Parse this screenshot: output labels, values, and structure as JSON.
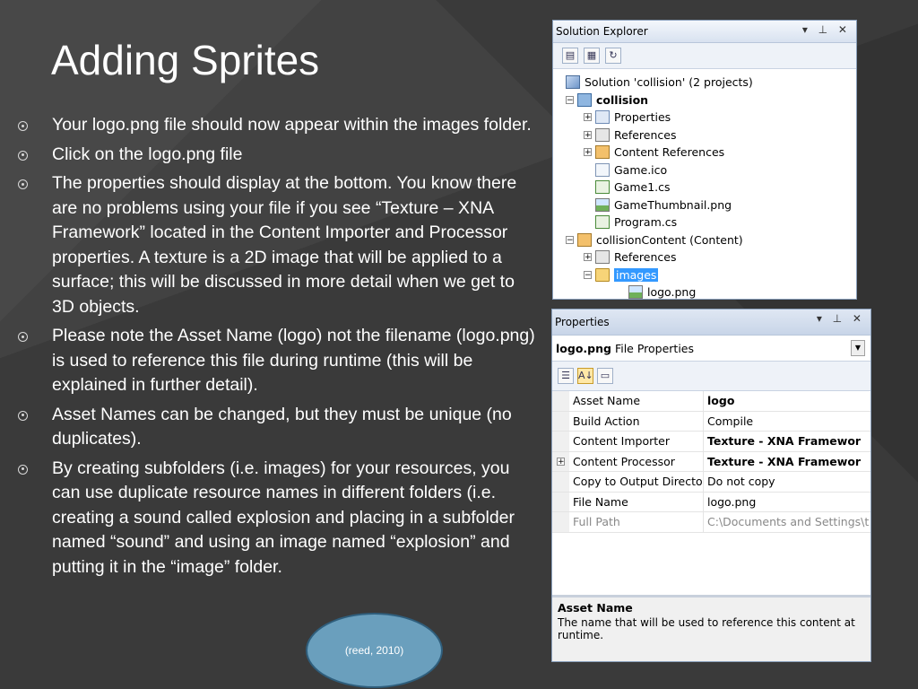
{
  "slide": {
    "title": "Adding Sprites",
    "bullets": [
      "Your logo.png file should now appear within the images folder.",
      "Click on the logo.png file",
      "The properties should display at the bottom.  You know there are no problems using your file if you see “Texture – XNA Framework” located in the Content Importer and Processor properties.  A texture is a 2D image that will be applied to a surface; this will be discussed in more detail when we get to 3D objects.",
      "Please note the Asset Name (logo) not the filename (logo.png) is used to reference this file during runtime (this will be explained in further detail).",
      "Asset Names can be changed, but they must be unique (no duplicates).",
      "By creating subfolders (i.e. images) for your resources, you can use duplicate resource names in different folders (i.e. creating a sound called explosion and placing in a subfolder named “sound” and using an image named “explosion” and putting it in the “image” folder."
    ],
    "citation": "(reed, 2010)"
  },
  "solution_explorer": {
    "title": "Solution Explorer",
    "window_controls": "▾ ⊥ ✕",
    "tree": [
      {
        "label": "Solution 'collision' (2 projects)",
        "icon": "solution-icon"
      },
      {
        "label": "collision",
        "icon": "project-icon"
      },
      {
        "label": "Properties",
        "icon": "properties-icon"
      },
      {
        "label": "References",
        "icon": "references-icon"
      },
      {
        "label": "Content References",
        "icon": "content-references-icon"
      },
      {
        "label": "Game.ico",
        "icon": "ico-file-icon"
      },
      {
        "label": "Game1.cs",
        "icon": "cs-file-icon"
      },
      {
        "label": "GameThumbnail.png",
        "icon": "png-file-icon"
      },
      {
        "label": "Program.cs",
        "icon": "cs-file-icon"
      },
      {
        "label": "collisionContent (Content)",
        "icon": "content-project-icon"
      },
      {
        "label": "References",
        "icon": "references-icon"
      },
      {
        "label": "images",
        "icon": "folder-open-icon"
      },
      {
        "label": "logo.png",
        "icon": "png-file-icon"
      }
    ]
  },
  "properties": {
    "title": "Properties",
    "window_controls": "▾ ⊥ ✕",
    "object_name": "logo.png",
    "object_type": "File Properties",
    "rows": [
      {
        "name": "Asset Name",
        "value": "logo"
      },
      {
        "name": "Build Action",
        "value": "Compile"
      },
      {
        "name": "Content Importer",
        "value": "Texture - XNA Framewor"
      },
      {
        "name": "Content Processor",
        "value": "Texture - XNA Framewor"
      },
      {
        "name": "Copy to Output Director",
        "value": "Do not copy"
      },
      {
        "name": "File Name",
        "value": "logo.png"
      },
      {
        "name": "Full Path",
        "value": "C:\\Documents and Settings\\t"
      }
    ],
    "description_title": "Asset Name",
    "description_text": "The name that will be used to reference this content at runtime."
  }
}
